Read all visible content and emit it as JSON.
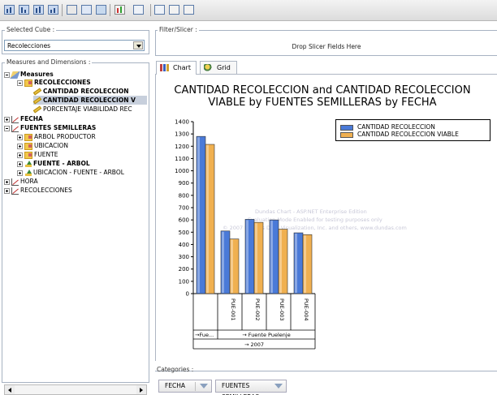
{
  "left_panel": {
    "selected_cube_label": "Selected Cube :",
    "selected_cube_value": "Recolecciones",
    "measures_label": "Measures and Dimensions :",
    "tree": [
      {
        "label": "Measures",
        "icon": "measures-icon",
        "bold": true
      },
      {
        "label": "RECOLECCIONES",
        "icon": "folder-icon",
        "bold": true
      },
      {
        "label": "CANTIDAD RECOLECCION",
        "icon": "measure-item-icon",
        "bold": true
      },
      {
        "label": "CANTIDAD RECOLECCION V",
        "icon": "measure-item-icon",
        "bold": true
      },
      {
        "label": "PORCENTAJE VIABILIDAD REC",
        "icon": "measure-item-icon",
        "bold": false
      },
      {
        "label": "FECHA",
        "icon": "dimension-icon",
        "bold": true
      },
      {
        "label": "FUENTES SEMILLERAS",
        "icon": "dimension-icon",
        "bold": true
      },
      {
        "label": "ARBOL PRODUCTOR",
        "icon": "folder-icon",
        "bold": false
      },
      {
        "label": "UBICACION",
        "icon": "folder-icon",
        "bold": false
      },
      {
        "label": "FUENTE",
        "icon": "folder-icon",
        "bold": false
      },
      {
        "label": "FUENTE - ARBOL",
        "icon": "hierarchy-icon",
        "bold": true
      },
      {
        "label": "UBICACION - FUENTE - ARBOL",
        "icon": "hierarchy-icon",
        "bold": false
      },
      {
        "label": "HORA",
        "icon": "dimension-icon",
        "bold": false
      },
      {
        "label": "RECOLECCIONES",
        "icon": "dimension-icon",
        "bold": false
      }
    ]
  },
  "slicer": {
    "label": "Filter/Slicer :",
    "drop_text": "Drop Slicer Fields Here"
  },
  "tabs": [
    {
      "label": "Chart",
      "active": true
    },
    {
      "label": "Grid",
      "active": false
    }
  ],
  "chart_data": {
    "type": "bar",
    "title": "CANTIDAD RECOLECCION and CANTIDAD RECOLECCION VIABLE by FUENTES SEMILLERAS by FECHA",
    "categories": [
      "PUE-001",
      "PUE-002",
      "PUE-003",
      "PUE-004"
    ],
    "first_category": "",
    "series": [
      {
        "name": "CANTIDAD RECOLECCION",
        "color": "#4a7ad8",
        "values": [
          1280,
          510,
          605,
          600,
          495
        ]
      },
      {
        "name": "CANTIDAD RECOLECCION VIABLE",
        "color": "#f0b050",
        "values": [
          1215,
          445,
          580,
          525,
          480
        ]
      }
    ],
    "yticks": [
      0,
      100,
      200,
      300,
      400,
      500,
      600,
      700,
      800,
      900,
      1000,
      1100,
      1200,
      1300,
      1400
    ],
    "ylim": [
      0,
      1400
    ],
    "grid": false,
    "legend": "top-right",
    "axis_groups": {
      "level1": [
        "→Fue...",
        "→ Fuente Puelenje"
      ],
      "level2": "→ 2007"
    }
  },
  "watermark": {
    "line1": "Dundas Chart - ASP.NET Enterprise Edition",
    "line2": "Evaluation Mode Enabled for testing purposes only",
    "line3": "© 2007 Dundas Data Visualization, Inc. and others, www.dundas.com"
  },
  "categories_zone": {
    "label": "Categories :",
    "fields": [
      "FECHA",
      "FUENTES SEMILLERAS"
    ]
  }
}
